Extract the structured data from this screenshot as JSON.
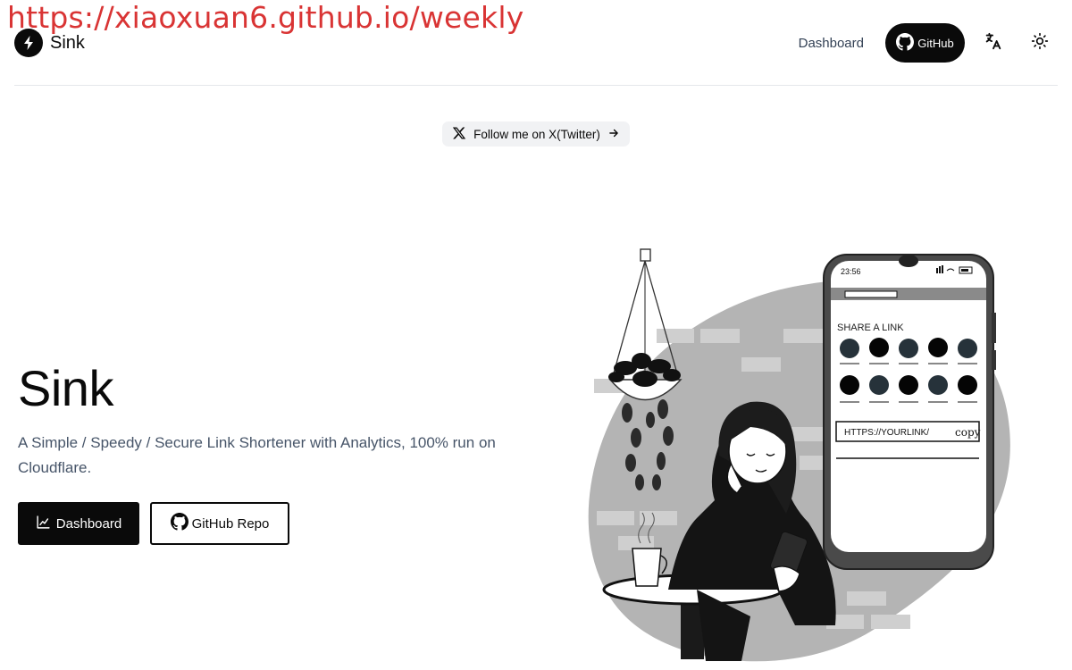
{
  "watermark": "https://xiaoxuan6.github.io/weekly",
  "header": {
    "logo_text": "Sink",
    "nav_dashboard": "Dashboard",
    "nav_github": "GitHub"
  },
  "follow": {
    "label": "Follow me on X(Twitter)"
  },
  "hero": {
    "title": "Sink",
    "description": "A Simple / Speedy / Secure Link Shortener with Analytics, 100% run on Cloudflare.",
    "primary_button": "Dashboard",
    "secondary_button": "GitHub Repo"
  },
  "illustration": {
    "phone_time": "23:56",
    "share_label": "SHARE A LINK",
    "url_placeholder": "HTTPS://YOURLINK/",
    "copy_label": "copy"
  },
  "colors": {
    "primary": "#0a0a0a",
    "muted_text": "#475569",
    "pill_bg": "#f1f2f4",
    "watermark": "#d93434"
  },
  "icons": [
    "bolt-icon",
    "github-icon",
    "translate-icon",
    "sun-icon",
    "x-logo-icon",
    "arrow-right-icon",
    "chart-icon"
  ]
}
